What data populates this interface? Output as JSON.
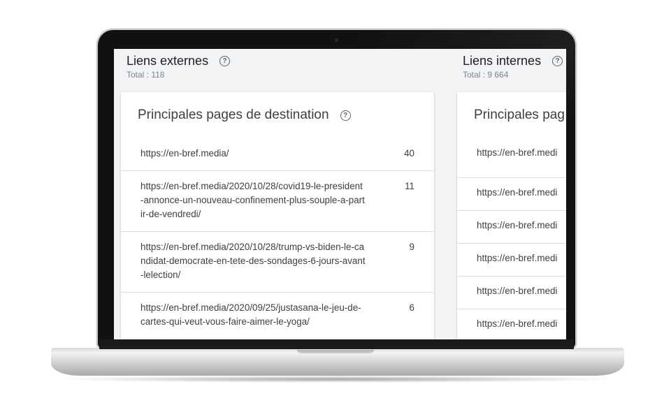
{
  "external": {
    "title": "Liens externes",
    "total": "Total : 118",
    "card_title": "Principales pages de destination",
    "rows": [
      {
        "url": "https://en-bref.media/",
        "count": "40"
      },
      {
        "url": "https://en-bref.media/2020/10/28/covid19-le-president-annonce-un-nouveau-confinement-plus-souple-a-partir-de-vendredi/",
        "count": "11"
      },
      {
        "url": "https://en-bref.media/2020/10/28/trump-vs-biden-le-candidat-democrate-en-tete-des-sondages-6-jours-avant-lelection/",
        "count": "9"
      },
      {
        "url": "https://en-bref.media/2020/09/25/justasana-le-jeu-de-cartes-qui-veut-vous-faire-aimer-le-yoga/",
        "count": "6"
      }
    ]
  },
  "internal": {
    "title": "Liens internes",
    "total": "Total : 9 664",
    "card_title": "Principales pag",
    "rows": [
      {
        "url": "https://en-bref.medi"
      },
      {
        "url": "https://en-bref.medi"
      },
      {
        "url": "https://en-bref.medi"
      },
      {
        "url": "https://en-bref.medi"
      },
      {
        "url": "https://en-bref.medi"
      },
      {
        "url": "https://en-bref.medi"
      }
    ]
  },
  "icons": {
    "help": "help-circle-icon"
  }
}
